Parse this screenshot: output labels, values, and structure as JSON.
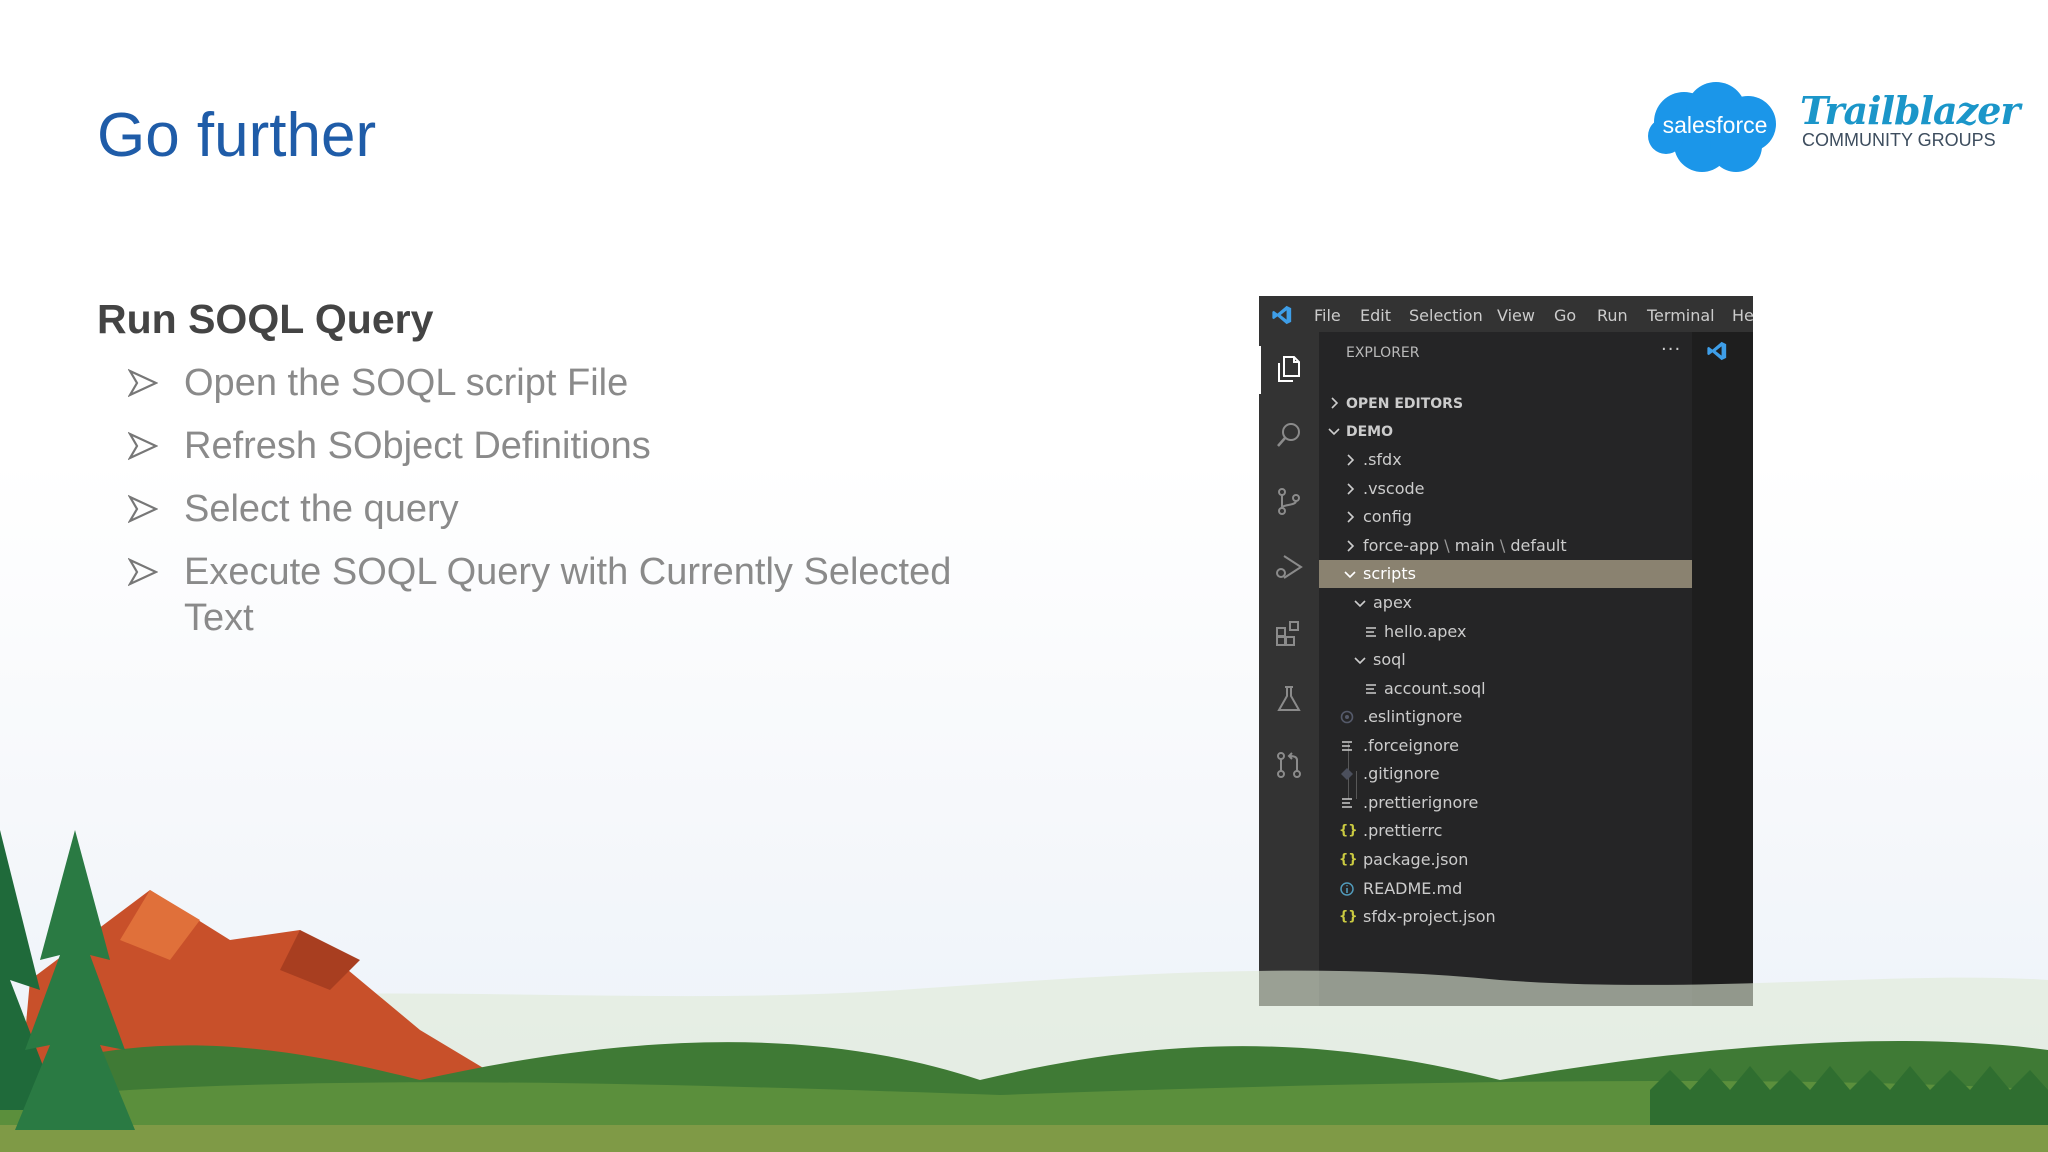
{
  "slide": {
    "title": "Go further",
    "section_title": "Run SOQL Query",
    "bullets": [
      "Open the SOQL script File",
      "Refresh SObject Definitions",
      "Select the query",
      "Execute SOQL Query with Currently Selected Text"
    ]
  },
  "logo": {
    "cloud_text": "salesforce",
    "brand": "Trailblazer",
    "sub": "COMMUNITY GROUPS",
    "colors": {
      "cloud": "#1b96e9",
      "brand": "#1b96c9"
    }
  },
  "vscode": {
    "menu": [
      "File",
      "Edit",
      "Selection",
      "View",
      "Go",
      "Run",
      "Terminal",
      "He"
    ],
    "activity_icons": [
      "explorer-icon",
      "search-icon",
      "source-control-icon",
      "run-debug-icon",
      "extensions-icon",
      "testing-icon",
      "pull-request-icon"
    ],
    "explorer_title": "EXPLORER",
    "more_actions": "···",
    "sections": {
      "open_editors": "OPEN EDITORS",
      "workspace": "DEMO"
    },
    "tree": {
      "sfdx": ".sfdx",
      "vscode": ".vscode",
      "config": "config",
      "force_app": "force-app",
      "path_sep": "\\",
      "main": "main",
      "default": "default",
      "scripts": "scripts",
      "apex": "apex",
      "hello_apex": "hello.apex",
      "soql": "soql",
      "account_soql": "account.soql",
      "eslintignore": ".eslintignore",
      "forceignore": ".forceignore",
      "gitignore": ".gitignore",
      "prettierignore": ".prettierignore",
      "prettierrc": ".prettierrc",
      "package_json": "package.json",
      "readme": "README.md",
      "sfdx_project": "sfdx-project.json"
    },
    "glyphs": {
      "json": "{}",
      "info": "i"
    },
    "colors": {
      "selected_row": "#8a8270",
      "json_icon": "#cbcb41",
      "info_icon": "#519aba",
      "accent": "#3e9ee8"
    }
  }
}
